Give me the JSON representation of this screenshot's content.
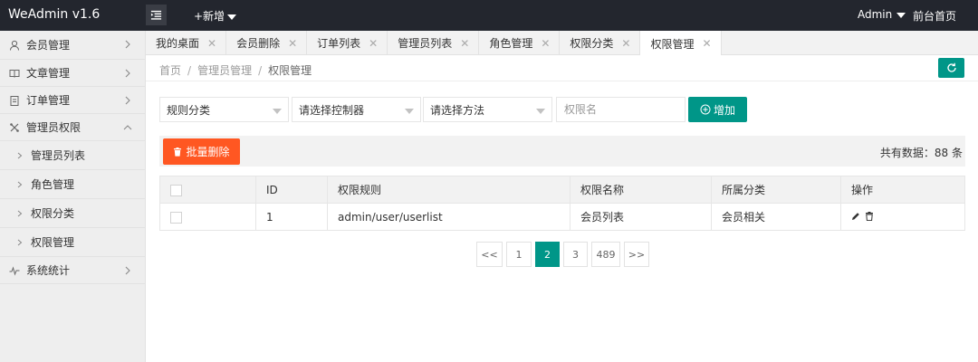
{
  "header": {
    "logo": "WeAdmin v1.6",
    "add_new": "+新增",
    "user": "Admin",
    "frontpage": "前台首页"
  },
  "sidebar": {
    "items": [
      {
        "label": "会员管理",
        "icon": "user-icon",
        "expanded": false
      },
      {
        "label": "文章管理",
        "icon": "book-icon",
        "expanded": false
      },
      {
        "label": "订单管理",
        "icon": "clipboard-icon",
        "expanded": false
      },
      {
        "label": "管理员权限",
        "icon": "tools-icon",
        "expanded": true
      },
      {
        "label": "系统统计",
        "icon": "pulse-icon",
        "expanded": false
      }
    ],
    "subitems": [
      "管理员列表",
      "角色管理",
      "权限分类",
      "权限管理"
    ]
  },
  "tabs": [
    {
      "label": "我的桌面",
      "active": false
    },
    {
      "label": "会员删除",
      "active": false
    },
    {
      "label": "订单列表",
      "active": false
    },
    {
      "label": "管理员列表",
      "active": false
    },
    {
      "label": "角色管理",
      "active": false
    },
    {
      "label": "权限分类",
      "active": false
    },
    {
      "label": "权限管理",
      "active": true
    }
  ],
  "breadcrumb": [
    "首页",
    "管理员管理",
    "权限管理"
  ],
  "filters": {
    "rule_category": "规则分类",
    "controller": "请选择控制器",
    "method": "请选择方法",
    "permission_name_placeholder": "权限名",
    "add_label": "增加"
  },
  "toolbar": {
    "batch_delete": "批量删除",
    "total_label": "共有数据：88 条"
  },
  "table": {
    "columns": [
      "ID",
      "权限规则",
      "权限名称",
      "所属分类",
      "操作"
    ],
    "rows": [
      {
        "id": "1",
        "rule": "admin/user/userlist",
        "name": "会员列表",
        "category": "会员相关"
      }
    ]
  },
  "pagination": {
    "prev": "<<",
    "pages": [
      "1",
      "2",
      "3",
      "489"
    ],
    "current": "2",
    "next": ">>"
  },
  "colors": {
    "header_bg": "#23262e",
    "accent": "#009688",
    "danger": "#ff5722"
  }
}
